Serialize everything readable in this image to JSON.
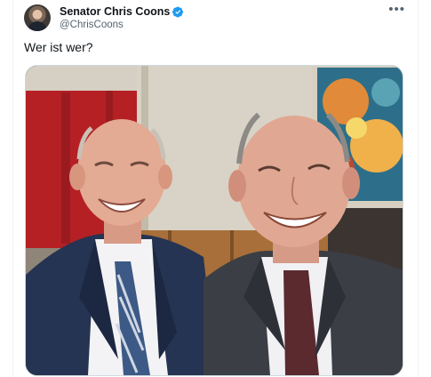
{
  "author": {
    "display_name": "Senator Chris Coons",
    "handle": "@ChrisCoons"
  },
  "post": {
    "text": "Wer ist wer?"
  },
  "icons": {
    "verified": "verified-badge-icon",
    "more": "more-options-icon"
  },
  "colors": {
    "accent": "#1d9bf0",
    "secondary_text": "#536471"
  }
}
